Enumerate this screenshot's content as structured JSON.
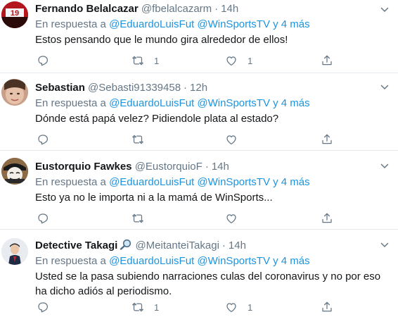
{
  "tweets": [
    {
      "name": "Fernando Belalcazar",
      "handle": "@fbelalcazarm",
      "time": "14h",
      "reply_prefix": "En respuesta a",
      "reply_users": "@EduardoLuisFut @WinSportsTV",
      "reply_more": "y 4 más",
      "text": "Estos pensando que le mundo gira alrededor de ellos!",
      "retweets": "1",
      "likes": "1",
      "avatar_text": "19"
    },
    {
      "name": "Sebastian",
      "handle": "@Sebasti91339458",
      "time": "12h",
      "reply_prefix": "En respuesta a",
      "reply_users": "@EduardoLuisFut @WinSportsTV",
      "reply_more": "y 4 más",
      "text": "Dónde está papá velez? Pidiendole plata al estado?",
      "retweets": "",
      "likes": ""
    },
    {
      "name": "Eustorquio Fawkes",
      "handle": "@EustorquioF",
      "time": "14h",
      "reply_prefix": "En respuesta a",
      "reply_users": "@EduardoLuisFut @WinSportsTV",
      "reply_more": "y 4 más",
      "text": "Esto ya no le importa ni a la mamá de WinSports...",
      "retweets": "",
      "likes": ""
    },
    {
      "name": "Detective Takagi",
      "handle": "@MeitanteiTakagi",
      "time": "14h",
      "reply_prefix": "En respuesta a",
      "reply_users": "@EduardoLuisFut @WinSportsTV",
      "reply_more": "y 4 más",
      "text": "Usted se la pasa subiendo narraciones culas del coronavirus y no por eso ha dicho adiós al periodismo.",
      "retweets": "1",
      "likes": "1"
    }
  ],
  "colors": {
    "link": "#1b95e0",
    "muted": "#657786",
    "text": "#14171a",
    "divider": "#e6ecf0"
  },
  "icons": [
    "reply-icon",
    "retweet-icon",
    "like-icon",
    "share-icon",
    "caret-down-icon",
    "magnifier-emoji-icon"
  ]
}
